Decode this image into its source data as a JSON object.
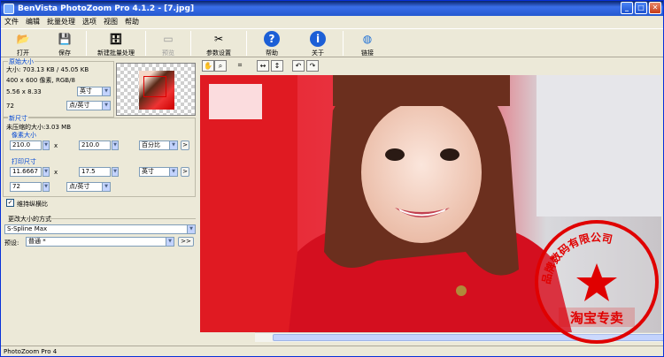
{
  "window": {
    "title": "BenVista PhotoZoom Pro 4.1.2 - [7.jpg]",
    "minimize": "_",
    "maximize": "□",
    "close": "✕"
  },
  "menu": [
    "文件",
    "编辑",
    "批量处理",
    "选项",
    "视图",
    "帮助"
  ],
  "toolbar": [
    {
      "label": "打开",
      "icon": "folder-icon",
      "glyph": "📂"
    },
    {
      "label": "保存",
      "icon": "floppy-icon",
      "glyph": "💾"
    },
    {
      "label": "新建批量处理",
      "icon": "database-icon",
      "glyph": "🗄"
    },
    {
      "label": "预览",
      "icon": "preview-icon",
      "glyph": "▭",
      "disabled": true
    },
    {
      "label": "参数设置",
      "icon": "tools-icon",
      "glyph": "✂"
    },
    {
      "label": "帮助",
      "icon": "help-icon",
      "glyph": "?"
    },
    {
      "label": "关于",
      "icon": "info-icon",
      "glyph": "i"
    },
    {
      "label": "链接",
      "icon": "globe-icon",
      "glyph": "◍"
    }
  ],
  "original": {
    "group_label": "原始大小",
    "size": "大小: 703.13 KB / 45.05 KB",
    "pixels": "400 x 600 像素, RGB/8",
    "dims": "5.56 x 8.33",
    "dims_unit": "英寸",
    "res": "72",
    "res_unit": "点/英寸"
  },
  "newsize": {
    "group_label": "新尺寸",
    "uncompressed": "未压缩的大小:3.03 MB",
    "pixel_label": "像素大小",
    "width": "210.0",
    "height": "210.0",
    "pixel_unit": "百分比",
    "print_label": "打印尺寸",
    "print_width": "11.6667",
    "print_height": "17.5",
    "print_unit": "英寸",
    "res": "72",
    "res_unit": "点/英寸",
    "x_sym": "x",
    "keep_ratio": "维持纵横比",
    "more": ">"
  },
  "method": {
    "group_label": "更改大小的方式",
    "algorithm": "S-Spline Max",
    "preset_label": "预设:",
    "preset": "普通 *",
    "more": ">>"
  },
  "status": "PhotoZoom Pro 4",
  "seal": {
    "text": "品牌数码有限公司",
    "stamp": "淘宝专卖",
    "color": "#e00000"
  }
}
